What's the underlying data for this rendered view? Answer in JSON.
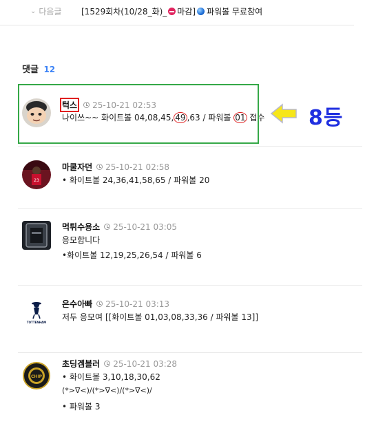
{
  "nav": {
    "prev_next_label": "다음글",
    "post_title_prefix": "[1529회차(10/28_화)_",
    "post_title_mid": "마감]",
    "post_title_suffix": "파워볼 무료참여"
  },
  "comments_section": {
    "title": "댓글",
    "count": "12"
  },
  "annotation": {
    "rank_label": "8등"
  },
  "comments": [
    {
      "nickname": "턱스",
      "date": "25-10-21 02:53",
      "text_a": "나이쓰~~ 화이트볼 04,08,45,",
      "circle_1": "49",
      "text_b": ",63 / 파워볼 ",
      "circle_2": "01",
      "text_c": " 접수"
    },
    {
      "nickname": "마쿨자던",
      "date": "25-10-21 02:58",
      "line1": "• 화이트볼 24,36,41,58,65 / 파워볼 20"
    },
    {
      "nickname": "먹튀수용소",
      "date": "25-10-21 03:05",
      "line1": "응모합니다",
      "line2": "•화이트볼 12,19,25,26,54 / 파워볼 6"
    },
    {
      "nickname": "은수아빠",
      "date": "25-10-21 03:13",
      "line1": "저두 응모여 [[화이트볼 01,03,08,33,36 / 파워볼 13]]"
    },
    {
      "nickname": "초딩겜블러",
      "date": "25-10-21 03:28",
      "line1": "• 화이트볼 3,10,18,30,62",
      "line2": "(*>∇<)/(*>∇<)/(*>∇<)/",
      "line3": "• 파워볼 3"
    }
  ]
}
